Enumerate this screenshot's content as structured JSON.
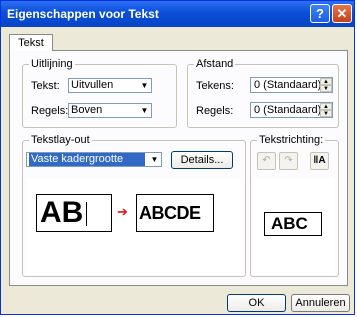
{
  "window": {
    "title": "Eigenschappen voor Tekst",
    "help_glyph": "?",
    "close_glyph": "✕"
  },
  "tabs": [
    {
      "label": "Tekst"
    }
  ],
  "uitlijning": {
    "legend": "Uitlijning",
    "tekst": {
      "label": "Tekst:",
      "value": "Uitvullen"
    },
    "regels": {
      "label": "Regels:",
      "value": "Boven"
    }
  },
  "afstand": {
    "legend": "Afstand",
    "tekens": {
      "label": "Tekens:",
      "value": "0 (Standaard)"
    },
    "regels": {
      "label": "Regels:",
      "value": "0 (Standaard)"
    }
  },
  "tekstlayout": {
    "legend": "Tekstlay-out",
    "select_value": "Vaste kadergrootte",
    "details_label": "Details...",
    "preview": {
      "left": "AB",
      "right": "ABCDE",
      "arrow": "➔"
    }
  },
  "tekstrichting": {
    "legend": "Tekstrichting:",
    "preview": "ABC",
    "btn1_glyph": "↶",
    "btn2_glyph": "↷",
    "btn3_glyph": "‖A"
  },
  "buttons": {
    "ok": "OK",
    "cancel": "Annuleren"
  },
  "colors": {
    "title_bar": "#0a4fd6",
    "selection": "#316ac5",
    "arrow": "#e81010"
  }
}
